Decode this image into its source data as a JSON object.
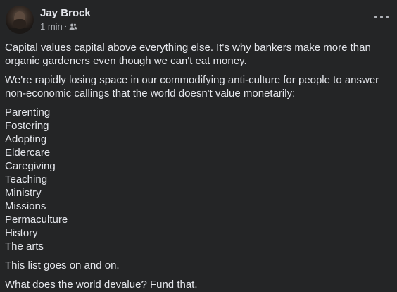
{
  "post": {
    "author": "Jay Brock",
    "time": "1 min",
    "separator": "·",
    "audience_icon": "friends-icon",
    "paragraph1": "Capital values capital above everything else. It's why bankers make more than organic gardeners even though we can't eat money.",
    "paragraph2": "We're rapidly losing space in our commodifying anti-culture for people to answer non-economic callings that the world doesn't value monetarily:",
    "list": [
      "Parenting",
      "Fostering",
      "Adopting",
      "Eldercare",
      "Caregiving",
      "Teaching",
      "Ministry",
      "Missions",
      "Permaculture",
      "History",
      "The arts"
    ],
    "paragraph3": "This list goes on and on.",
    "paragraph4": "What does the world devalue? Fund that."
  },
  "colors": {
    "background": "#242526",
    "primary_text": "#e4e6eb",
    "secondary_text": "#b0b3b8"
  }
}
